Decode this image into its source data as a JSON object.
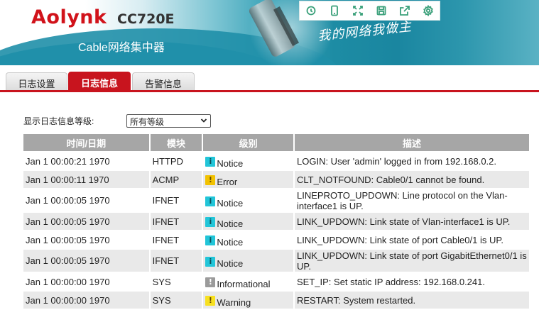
{
  "header": {
    "brand": "Aolynk",
    "model": "CC720E",
    "subtitle": "Cable网络集中器",
    "slogan": "我的网络我做主",
    "toolbar": [
      {
        "name": "refresh-icon"
      },
      {
        "name": "mobile-icon"
      },
      {
        "name": "fullscreen-icon"
      },
      {
        "name": "save-icon"
      },
      {
        "name": "export-icon"
      },
      {
        "name": "settings-icon"
      }
    ]
  },
  "tabs": [
    {
      "label": "日志设置",
      "active": false
    },
    {
      "label": "日志信息",
      "active": true
    },
    {
      "label": "告警信息",
      "active": false
    }
  ],
  "filter": {
    "label": "显示日志信息等级:",
    "selected": "所有等级"
  },
  "table": {
    "headers": [
      "时间/日期",
      "模块",
      "级别",
      "描述"
    ],
    "level_colors": {
      "Notice": "#22c5d8",
      "Error": "#f2c200",
      "Informational": "#9b9b9b",
      "Warning": "#f7e020"
    },
    "rows": [
      {
        "time": "Jan 1 00:00:21 1970",
        "module": "HTTPD",
        "level": "Notice",
        "desc": "LOGIN: User 'admin' logged in from 192.168.0.2."
      },
      {
        "time": "Jan 1 00:00:11 1970",
        "module": "ACMP",
        "level": "Error",
        "desc": "CLT_NOTFOUND: Cable0/1 cannot be found."
      },
      {
        "time": "Jan 1 00:00:05 1970",
        "module": "IFNET",
        "level": "Notice",
        "desc": "LINEPROTO_UPDOWN: Line protocol on the Vlan-interface1 is UP."
      },
      {
        "time": "Jan 1 00:00:05 1970",
        "module": "IFNET",
        "level": "Notice",
        "desc": "LINK_UPDOWN: Link state of Vlan-interface1 is UP."
      },
      {
        "time": "Jan 1 00:00:05 1970",
        "module": "IFNET",
        "level": "Notice",
        "desc": "LINK_UPDOWN: Link state of port Cable0/1 is UP."
      },
      {
        "time": "Jan 1 00:00:05 1970",
        "module": "IFNET",
        "level": "Notice",
        "desc": "LINK_UPDOWN: Link state of port GigabitEthernet0/1 is UP."
      },
      {
        "time": "Jan 1 00:00:00 1970",
        "module": "SYS",
        "level": "Informational",
        "desc": "SET_IP: Set static IP address: 192.168.0.241."
      },
      {
        "time": "Jan 1 00:00:00 1970",
        "module": "SYS",
        "level": "Warning",
        "desc": "RESTART: System restarted."
      }
    ]
  }
}
